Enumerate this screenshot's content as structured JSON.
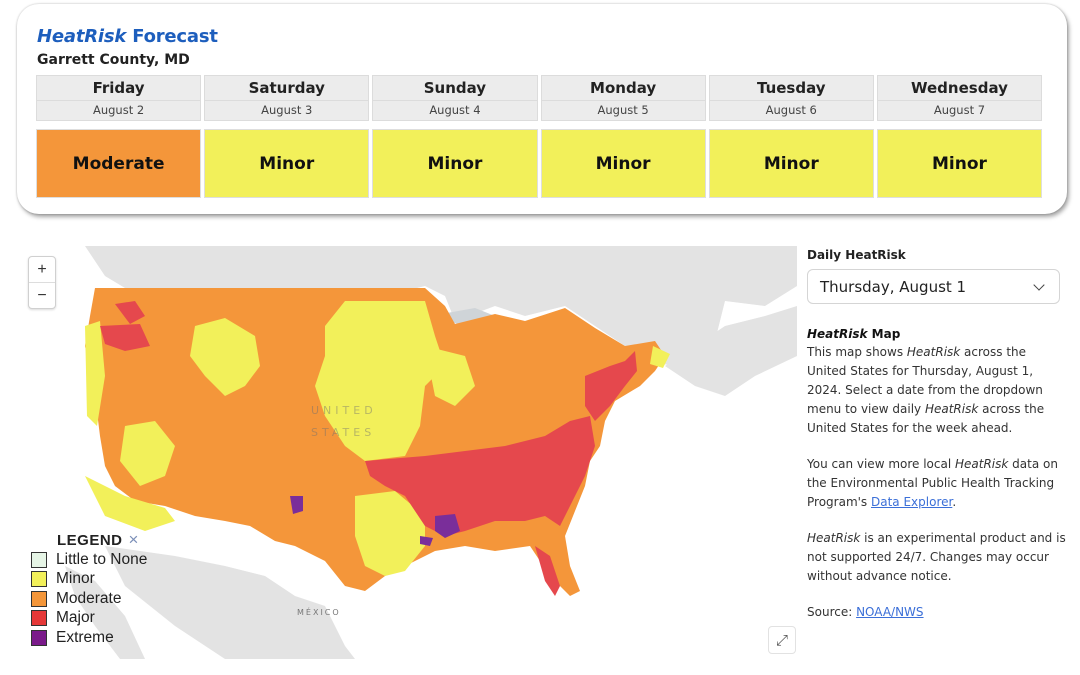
{
  "forecast": {
    "title_italic": "HeatRisk",
    "title_rest": " Forecast",
    "location": "Garrett County, MD",
    "days": [
      {
        "day": "Friday",
        "date": "August 2",
        "risk": "Moderate",
        "color": "#f4963a"
      },
      {
        "day": "Saturday",
        "date": "August 3",
        "risk": "Minor",
        "color": "#f2f05a"
      },
      {
        "day": "Sunday",
        "date": "August 4",
        "risk": "Minor",
        "color": "#f2f05a"
      },
      {
        "day": "Monday",
        "date": "August 5",
        "risk": "Minor",
        "color": "#f2f05a"
      },
      {
        "day": "Tuesday",
        "date": "August 6",
        "risk": "Minor",
        "color": "#f2f05a"
      },
      {
        "day": "Wednesday",
        "date": "August 7",
        "risk": "Minor",
        "color": "#f2f05a"
      }
    ]
  },
  "map": {
    "zoom_in": "+",
    "zoom_out": "−",
    "expand_icon": "⤢",
    "labels": {
      "country_line1": "UNITED",
      "country_line2": "STATES",
      "mexico": "MÉXICO"
    },
    "legend": {
      "title": "LEGEND",
      "close": "×",
      "items": [
        {
          "label": "Little to None",
          "color": "#e6f5e6"
        },
        {
          "label": "Minor",
          "color": "#f2f05a"
        },
        {
          "label": "Moderate",
          "color": "#f4963a"
        },
        {
          "label": "Major",
          "color": "#e53838"
        },
        {
          "label": "Extreme",
          "color": "#7a1a8a"
        }
      ]
    }
  },
  "side": {
    "label": "Daily HeatRisk",
    "selected_date": "Thursday, August 1",
    "heading_italic": "HeatRisk",
    "heading_rest": " Map",
    "p1_a": "This map shows ",
    "p1_i": "HeatRisk",
    "p1_b": " across the United States for Thursday, August 1, 2024. Select a date from the dropdown menu to view daily ",
    "p1_i2": "HeatRisk",
    "p1_c": " across the United States for the week ahead.",
    "p2_a": "You can view more local ",
    "p2_i": "HeatRisk",
    "p2_b": " data on the Environmental Public Health Tracking Program's ",
    "p2_link": "Data Explorer",
    "p2_c": ".",
    "p3_i": "HeatRisk",
    "p3_b": " is an experimental product and is not supported 24/7. Changes may occur without advance notice.",
    "source_label": "Source: ",
    "source_link": "NOAA/NWS"
  }
}
